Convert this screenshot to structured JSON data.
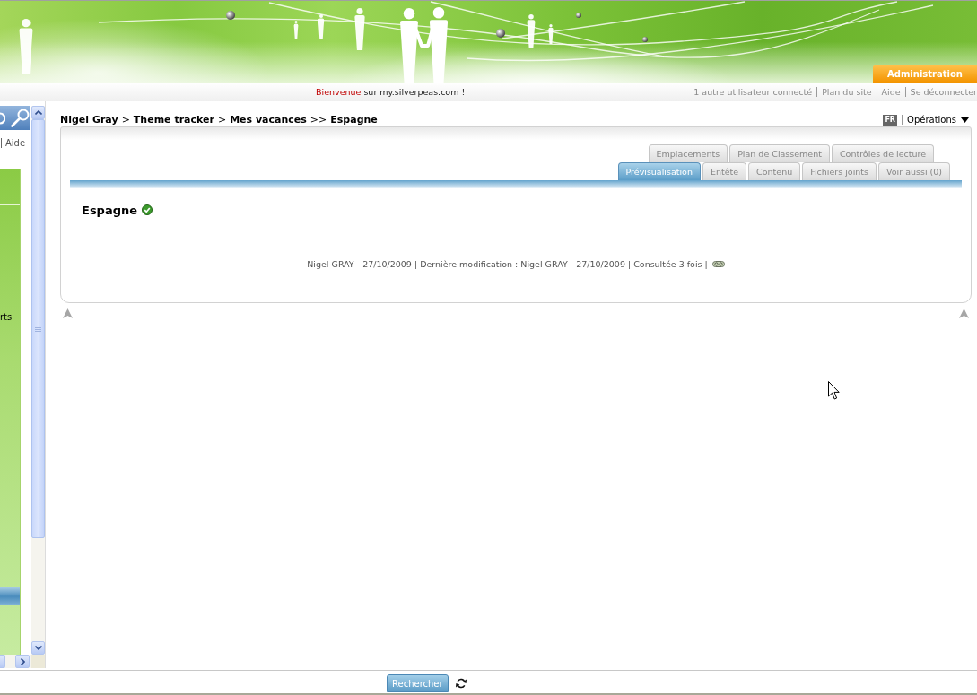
{
  "banner": {
    "admin_tab": "Administration"
  },
  "welcome_bar": {
    "greeting": "Bienvenue",
    "message": "sur my.silverpeas.com !",
    "links": [
      "1 autre utilisateur connecté",
      "Plan du site",
      "Aide",
      "Se déconnecter"
    ]
  },
  "sidebar": {
    "links": [
      "Aide"
    ],
    "menu_items": [
      "rts"
    ]
  },
  "breadcrumb": [
    {
      "label": "Nigel Gray",
      "separator": ">"
    },
    {
      "label": "Theme tracker",
      "separator": ">"
    },
    {
      "label": "Mes vacances",
      "separator": ">>"
    },
    {
      "label": "Espagne"
    }
  ],
  "language": "FR",
  "operations_menu": "Opérations",
  "tab_rows": [
    {
      "tabs": [
        {
          "label": "Emplacements",
          "selected": false
        },
        {
          "label": "Plan de Classement",
          "selected": false
        },
        {
          "label": "Contrôles de lecture",
          "selected": false
        }
      ]
    },
    {
      "tabs": [
        {
          "label": "Prévisualisation",
          "selected": true
        },
        {
          "label": "Entête",
          "selected": false
        },
        {
          "label": "Contenu",
          "selected": false
        },
        {
          "label": "Fichiers joints",
          "selected": false
        },
        {
          "label": "Voir aussi (0)",
          "selected": false
        }
      ]
    }
  ],
  "publication": {
    "title": "Espagne",
    "validated": true,
    "info": "Nigel GRAY - 27/10/2009 | Dernière modification : Nigel GRAY - 27/10/2009 | Consultée 3 fois |"
  },
  "footer": {
    "search_button": "Rechercher"
  }
}
